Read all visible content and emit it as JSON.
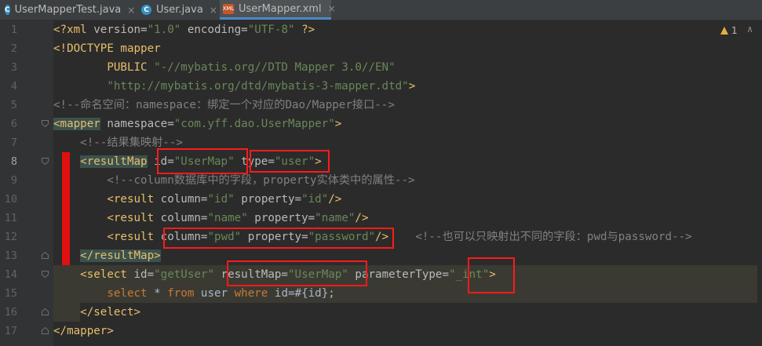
{
  "tabs": [
    {
      "label": "UserMapperTest.java",
      "icon": "java-class-icon",
      "active": false
    },
    {
      "label": "User.java",
      "icon": "java-class-icon",
      "active": false
    },
    {
      "label": "UserMapper.xml",
      "icon": "xml-file-icon",
      "active": true
    }
  ],
  "tab_icon_letter": "C",
  "tab_xml_icon_text": "XML",
  "tab_close": "×",
  "inspection": {
    "count": "1",
    "chevron": "∧"
  },
  "line_numbers": [
    "1",
    "2",
    "3",
    "4",
    "5",
    "6",
    "7",
    "8",
    "9",
    "10",
    "11",
    "12",
    "13",
    "14",
    "15",
    "16",
    "17"
  ],
  "code": {
    "l1": {
      "decl_open": "<?xml",
      "version_attr": " version=",
      "version_val": "\"1.0\"",
      "enc_attr": " encoding=",
      "enc_val": "\"UTF-8\"",
      "decl_close": " ?>"
    },
    "l2": {
      "doctype": "<!DOCTYPE",
      "name": " mapper"
    },
    "l3": {
      "indent": "        ",
      "public": "PUBLIC",
      "pubid": " \"-//mybatis.org//DTD Mapper 3.0//EN\""
    },
    "l4": {
      "indent": "        ",
      "dtd": "\"http://mybatis.org/dtd/mybatis-3-mapper.dtd\"",
      "close": ">"
    },
    "l5": {
      "comment": "<!--命名空间：namespace：绑定一个对应的Dao/Mapper接口-->"
    },
    "l6": {
      "open": "<mapper",
      "attr": " namespace=",
      "val": "\"com.yff.dao.UserMapper\"",
      "close": ">"
    },
    "l7": {
      "indent": "    ",
      "comment": "<!--结果集映射-->"
    },
    "l8": {
      "indent": "    ",
      "open": "<resultMap",
      "id_attr": " id=",
      "id_val": "\"UserMap\"",
      "type_attr": " type=",
      "type_val": "\"user\"",
      "close": ">"
    },
    "l9": {
      "indent": "        ",
      "comment": "<!--column数据库中的字段，property实体类中的属性-->"
    },
    "l10": {
      "indent": "        ",
      "open": "<result",
      "col_attr": " column=",
      "col_val": "\"id\"",
      "prop_attr": " property=",
      "prop_val": "\"id\"",
      "close": "/>"
    },
    "l11": {
      "indent": "        ",
      "open": "<result",
      "col_attr": " column=",
      "col_val": "\"name\"",
      "prop_attr": " property=",
      "prop_val": "\"name\"",
      "close": "/>"
    },
    "l12": {
      "indent": "        ",
      "open": "<result",
      "col_attr": " column=",
      "col_val": "\"pwd\"",
      "prop_attr": " property=",
      "prop_val": "\"password\"",
      "close": "/>",
      "gap": "    ",
      "comment": "<!--也可以只映射出不同的字段：pwd与password-->"
    },
    "l13": {
      "indent": "    ",
      "close_tag": "</resultMap>"
    },
    "l14": {
      "indent": "    ",
      "open": "<select",
      "id_attr": " id=",
      "id_val": "\"getUser\"",
      "rm_attr": " resultMap=",
      "rm_val": "\"UserMap\"",
      "pt_attr": " parameterType=",
      "pt_val": "\"_int\"",
      "close": ">"
    },
    "l15": {
      "indent": "        ",
      "kw_select": "select",
      "star": " * ",
      "kw_from": "from",
      "table": " user ",
      "kw_where": "where",
      "cond": " id=#{id};"
    },
    "l16": {
      "indent": "    ",
      "close_tag": "</select>"
    },
    "l17": {
      "close_tag": "</mapper>"
    }
  },
  "colors": {
    "background": "#2b2b2b",
    "tag": "#e8bf6a",
    "attribute": "#bababa",
    "string": "#6a8759",
    "comment": "#808080",
    "keyword": "#cc7832",
    "annotation_red": "#ff1a1a"
  }
}
